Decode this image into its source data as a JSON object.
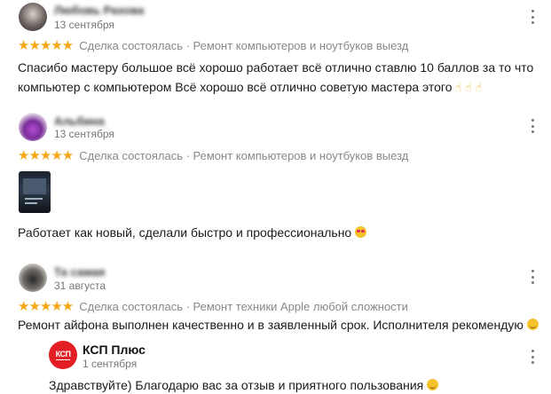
{
  "reviews": [
    {
      "author": "Любовь Рахова",
      "date": "13 сентября",
      "stars": "★★★★★",
      "deal": "Сделка состоялась · Ремонт компьютеров и ноутбуков выезд",
      "text_line1": "Спасибо мастеру большое всё хорошо работает всё отлично ставлю 10 баллов за то что",
      "text_line2": "компьютер с компьютером Всё хорошо всё отлично советую мастера этого",
      "emoji": "☝ ☝ ☝"
    },
    {
      "author": "Альбина",
      "date": "13 сентября",
      "stars": "★★★★★",
      "deal": "Сделка состоялась · Ремонт компьютеров и ноутбуков выезд",
      "text": "Работает как новый, сделали быстро и профессионально"
    },
    {
      "author": "Та самая",
      "date": "31 августа",
      "stars": "★★★★★",
      "deal": "Сделка состоялась · Ремонт техники Apple любой сложности",
      "text": "Ремонт айфона выполнен качественно и в заявленный срок. Исполнителя рекомендую"
    }
  ],
  "reply": {
    "logo_text": "КСП",
    "company": "КСП Плюс",
    "date": "1 сентября",
    "text": "Здравствуйте) Благодарю вас за отзыв и приятного пользования"
  },
  "colors": {
    "stars": "#f7a716",
    "logo": "#e31e24"
  },
  "icons": [
    "more-vertical-icon",
    "pointing-up-icon",
    "heart-eyes-emoji-icon",
    "smile-emoji-icon"
  ]
}
